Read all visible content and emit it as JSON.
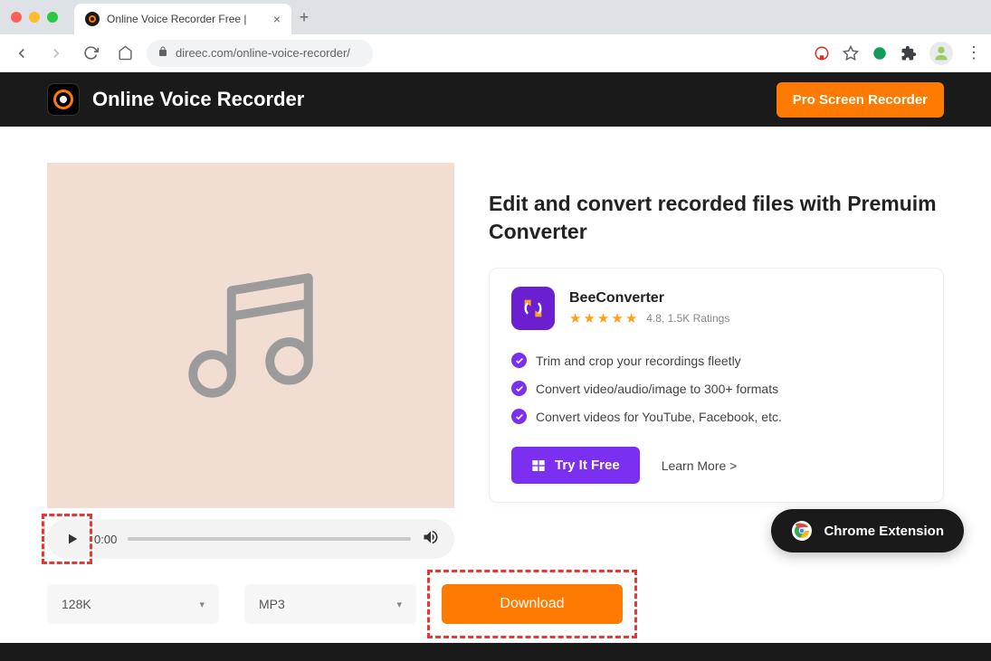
{
  "browser": {
    "tab_title": "Online Voice Recorder Free |",
    "url": "direec.com/online-voice-recorder/"
  },
  "header": {
    "logo_text": "Online Voice Recorder",
    "pro_button": "Pro Screen Recorder"
  },
  "player": {
    "time": "0:00"
  },
  "controls": {
    "bitrate": "128K",
    "format": "MP3",
    "download": "Download"
  },
  "promo": {
    "heading": "Edit and convert recorded files with Premuim Converter",
    "product_name": "BeeConverter",
    "rating_text": "4.8, 1.5K Ratings",
    "features": [
      "Trim and crop your recordings fleetly",
      "Convert video/audio/image to 300+ formats",
      "Convert videos for YouTube, Facebook, etc."
    ],
    "try_button": "Try It Free",
    "learn_more": "Learn More >"
  },
  "chrome_ext": {
    "label": "Chrome Extension"
  }
}
